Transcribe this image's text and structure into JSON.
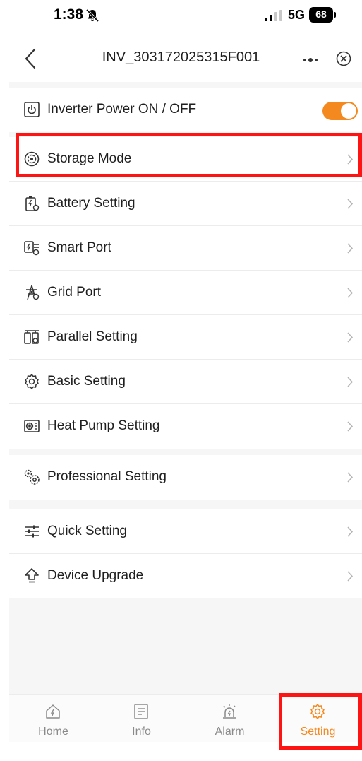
{
  "status_bar": {
    "time": "1:38",
    "network": "5G",
    "battery": "68"
  },
  "nav": {
    "title": "INV_303172025315F001"
  },
  "colors": {
    "accent": "#f4891f",
    "highlight": "#ff1414",
    "toggle_on": "#f4891f"
  },
  "settings": {
    "power": {
      "label": "Inverter Power ON / OFF",
      "icon": "power-icon",
      "on": true
    },
    "group_main": [
      {
        "label": "Storage Mode",
        "icon": "storage-mode-icon"
      },
      {
        "label": "Battery Setting",
        "icon": "battery-setting-icon"
      },
      {
        "label": "Smart Port",
        "icon": "smart-port-icon"
      },
      {
        "label": "Grid Port",
        "icon": "grid-port-icon"
      },
      {
        "label": "Parallel Setting",
        "icon": "parallel-setting-icon"
      },
      {
        "label": "Basic Setting",
        "icon": "gear-icon"
      },
      {
        "label": "Heat Pump Setting",
        "icon": "heat-pump-icon"
      }
    ],
    "group_pro": [
      {
        "label": "Professional Setting",
        "icon": "double-gear-icon"
      }
    ],
    "group_tools": [
      {
        "label": "Quick Setting",
        "icon": "sliders-icon"
      },
      {
        "label": "Device Upgrade",
        "icon": "upgrade-arrow-icon"
      }
    ]
  },
  "tabs": [
    {
      "label": "Home",
      "icon": "home-icon",
      "active": false
    },
    {
      "label": "Info",
      "icon": "info-document-icon",
      "active": false
    },
    {
      "label": "Alarm",
      "icon": "alarm-siren-icon",
      "active": false
    },
    {
      "label": "Setting",
      "icon": "gear-icon",
      "active": true
    }
  ]
}
